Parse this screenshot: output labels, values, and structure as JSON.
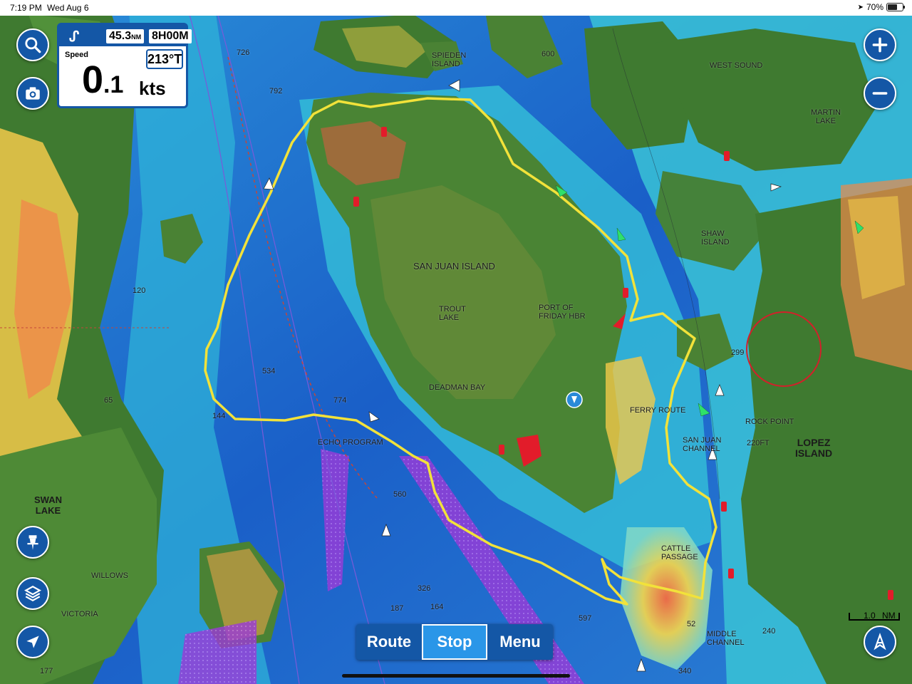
{
  "status_bar": {
    "time": "7:19 PM",
    "date": "Wed Aug 6",
    "battery": "70%"
  },
  "speed_panel": {
    "distance_value": "45.3",
    "distance_unit": "NM",
    "time_value": "8H00M",
    "speed_label": "Speed",
    "speed_whole": "0",
    "speed_decimal": ".1",
    "speed_unit": "kts",
    "heading": "213°T"
  },
  "toolbar": {
    "route_label": "Route",
    "stop_label": "Stop",
    "menu_label": "Menu"
  },
  "scale_bar": {
    "value": "1.0",
    "unit": "NM"
  },
  "map_labels": {
    "san_juan_island": "SAN JUAN ISLAND",
    "trout_lake": "TROUT\nLAKE",
    "port_of_friday_hbr": "PORT OF\nFRIDAY HBR",
    "deadman_bay": "DEADMAN BAY",
    "ferry_route": "FERRY ROUTE",
    "san_juan_channel": "SAN JUAN\nCHANNEL",
    "rock_point": "ROCK POINT",
    "lopez_island": "LOPEZ\nISLAND",
    "shaw_island": "SHAW\nISLAND",
    "west_sound": "WEST SOUND",
    "martin_lake": "MARTIN\nLAKE",
    "spieden_island": "SPIEDEN\nISLAND",
    "swan_lake": "SWAN\nLAKE",
    "willows": "WILLOWS",
    "victoria": "VICTORIA",
    "echo_program": "ECHO PROGRAM",
    "cattle_pass": "CATTLE\nPASSAGE",
    "middle_channel": "MIDDLE\nCHANNEL",
    "depth_220ft": "220FT",
    "depth_774": "774",
    "depth_534": "534",
    "depth_792": "792",
    "depth_600": "600",
    "depth_299": "299",
    "depth_240": "240",
    "depth_560": "560",
    "depth_144": "144",
    "depth_120": "120",
    "depth_326": "326",
    "depth_597": "597",
    "depth_164": "164",
    "depth_187": "187",
    "depth_177": "177",
    "depth_340": "340",
    "depth_52": "52",
    "depth_726": "726",
    "depth_65": "65"
  },
  "icons": [
    "search-icon",
    "camera-icon",
    "zoom-in-icon",
    "zoom-out-icon",
    "pin-icon",
    "layers-icon",
    "location-arrow-icon",
    "follow-icon",
    "map-marker-icon"
  ],
  "colors": {
    "panel_blue": "#1457a6",
    "active_blue": "#2a96e8",
    "track_yellow": "#f2e23a",
    "deep_water": "#1a6fd0",
    "shallow_water": "#3ec8d8",
    "land_green": "#3f7a30"
  }
}
